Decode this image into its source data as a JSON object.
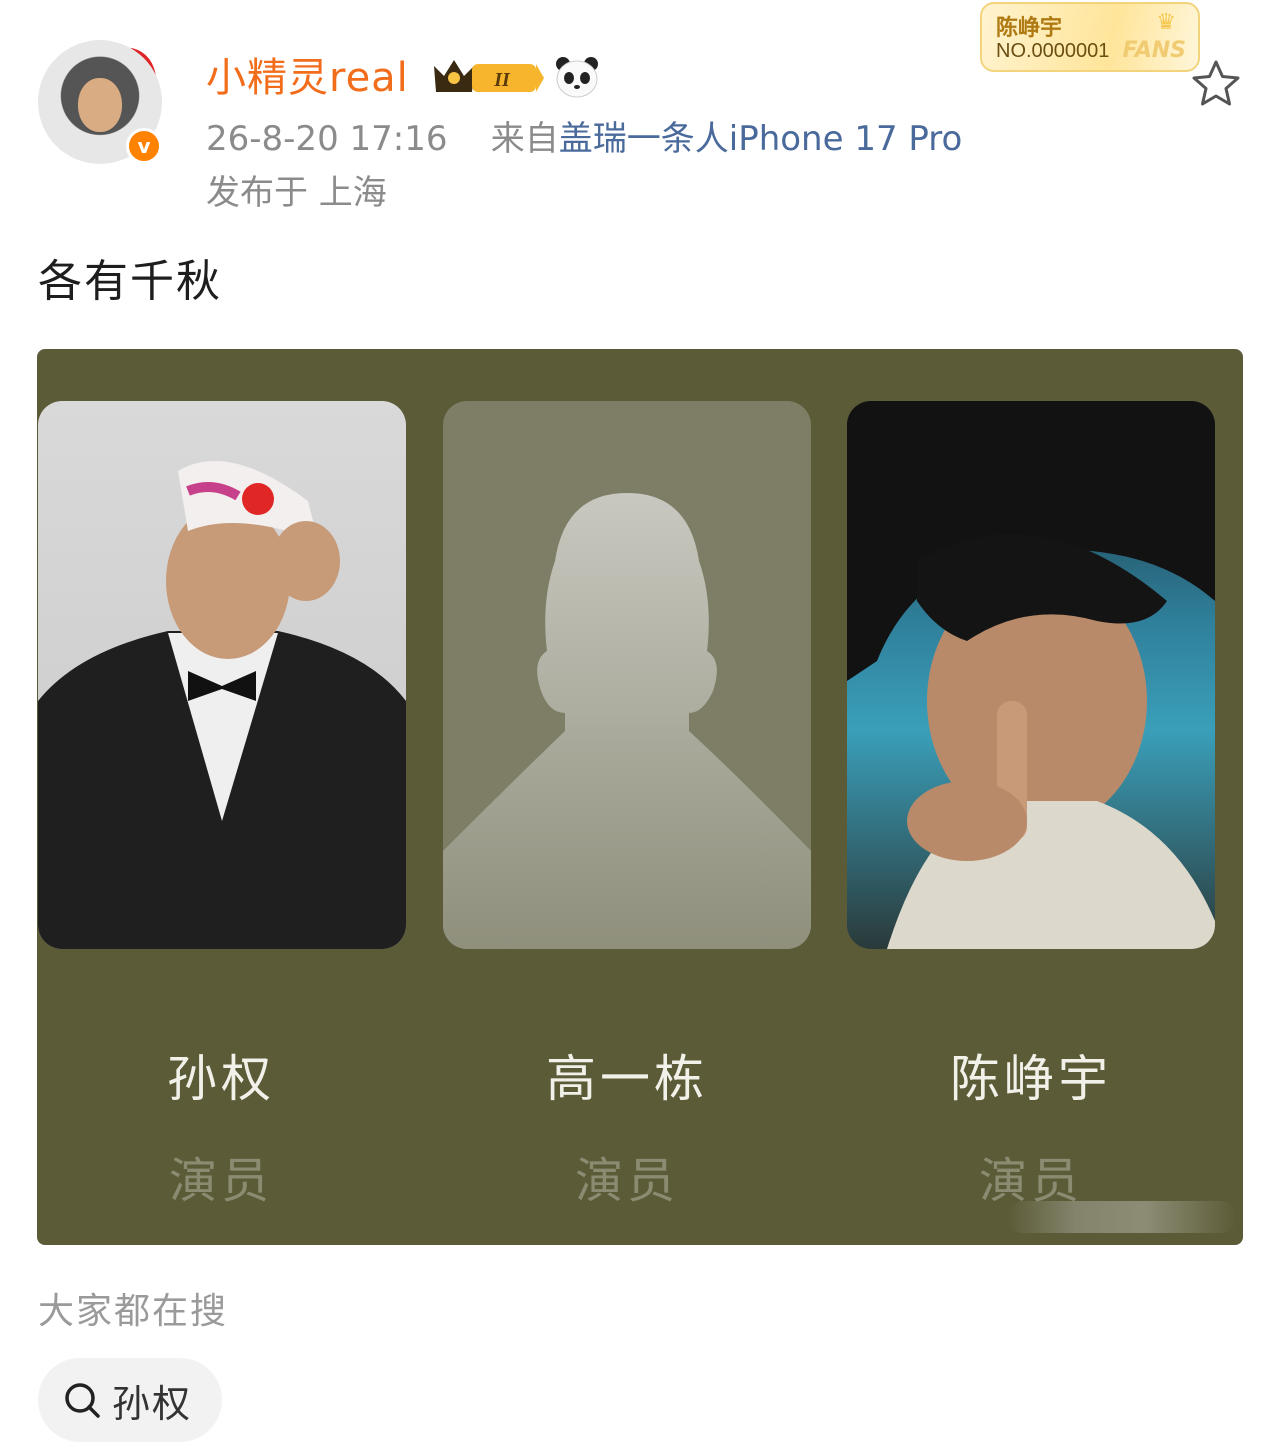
{
  "post": {
    "username": "小精灵real",
    "time": "26-8-20 17:16",
    "from_prefix": "来自",
    "device": "盖瑞一条人iPhone 17 Pro",
    "location": "发布于 上海",
    "text": "各有千秋"
  },
  "fans_card": {
    "name": "陈峥宇",
    "number": "NO.0000001",
    "word": "FANS"
  },
  "level_badge": "II",
  "panel": {
    "people": [
      {
        "name": "孙权",
        "role": "演员"
      },
      {
        "name": "高一栋",
        "role": "演员"
      },
      {
        "name": "陈峥宇",
        "role": "演员"
      }
    ]
  },
  "search": {
    "title": "大家都在搜",
    "chip": "孙权"
  },
  "colors": {
    "username": "#f26d1b",
    "device_link": "#4a6a9c",
    "panel_bg": "#5b5b37",
    "verified": "#ff8200"
  },
  "icons": {
    "star": "star-icon",
    "search": "search-icon",
    "verified": "verified-v-icon",
    "crown": "crown-icon",
    "panda": "panda-icon"
  }
}
